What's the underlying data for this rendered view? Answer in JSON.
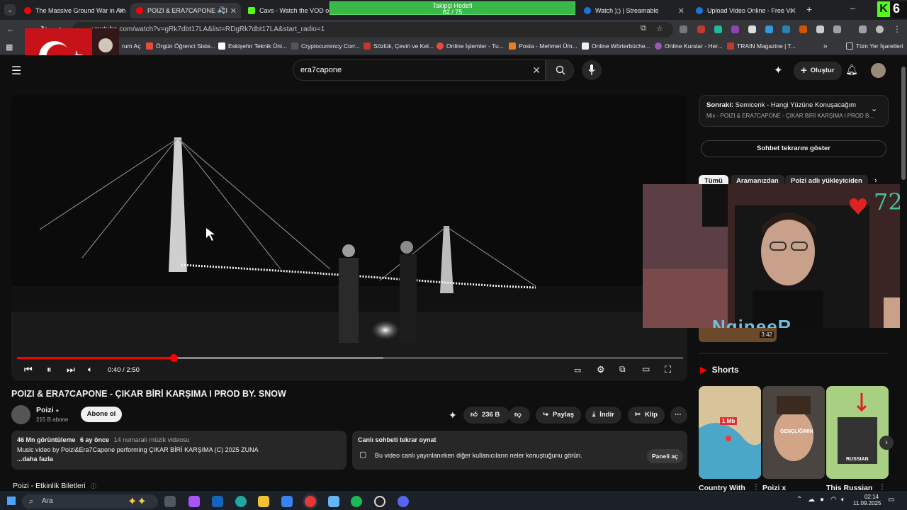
{
  "browser": {
    "tabs": [
      {
        "title": "The Massive Ground War in Am",
        "icon_color": "#ff0000"
      },
      {
        "title": "POIZI & ERA7CAPONE - ÇI",
        "icon_color": "#ff0000"
      },
      {
        "title": "Cavs - Watch the VOD on Ki",
        "icon_color": "#53fc18"
      },
      {
        "title": "Watch };) | Streamable",
        "icon_color": "#1a73e8"
      },
      {
        "title": "Upload Video Online - Free Vi",
        "icon_color": "#1a73e8"
      }
    ],
    "overlay_goal": {
      "line1": "Takipçi Hedefi",
      "line2": "82 / 75"
    },
    "url": "youtube.com/watch?v=gRk7dbt17LA&list=RDgRk7dbt17LA&start_radio=1",
    "bookmarks": [
      "rum Aç",
      "Örgün Öğrenci Siste...",
      "Eskişehir Teknik Üni...",
      "Cryptocurrency Corr...",
      "Sözlük, Çeviri ve Kel...",
      "Online İşlemler - Tu...",
      "Posta - Mehmet Üm...",
      "Online Wörterbüche...",
      "Online Kurslar - Her...",
      "TRAIN Magazine | T..."
    ],
    "all_bookmarks": "Tüm Yer İşaretleri",
    "overlay_k_badge": "6"
  },
  "youtube": {
    "search_value": "era7capone",
    "create_label": "Oluştur",
    "player": {
      "time": "0:40 / 2:50",
      "progress_fraction": 0.235,
      "buffer_fraction": 0.55
    },
    "video_title": "POIZI & ERA7CAPONE - ÇIKAR BİRİ KARŞIMA I PROD BY. SNOW",
    "channel": {
      "name": "Poizi",
      "subs": "215 B abone",
      "subscribe": "Abone ol"
    },
    "actions": {
      "likes": "236 B",
      "share": "Paylaş",
      "download": "İndir",
      "clip": "Klip"
    },
    "description": {
      "views": "46 Mn görüntüleme",
      "ago": "6 ay önce",
      "rank": "14 numaralı müzik videosu",
      "text": "Music video by Poizi&Era7Capone performing ÇIKAR BİRİ KARŞIMA (C) 2025 ZUNA",
      "more": "...daha fazla"
    },
    "live_chat_card": {
      "title": "Canlı sohbeti tekrar oynat",
      "text": "Bu video canlı yayınlanırken diğer kullanıcıların neler konuştuğunu görün.",
      "button": "Paneli aç"
    },
    "events": "Poizi - Etkinlik Biletleri",
    "sidebar": {
      "next_prefix": "Sonraki:",
      "next_title": "Semicenk - Hangi Yüzüne Konuşacağım",
      "next_sub": "Mix - POIZI & ERA7CAPONE - ÇIKAR BİRİ KARŞIMA I PROD B...",
      "chat_replay": "Sohbet tekrarını göster",
      "chips": [
        "Tümü",
        "Aramanızdan",
        "Poizi adlı yükleyiciden"
      ],
      "thumb_duration": "3:42",
      "shorts_heading": "Shorts",
      "shorts": [
        {
          "title": "Country With",
          "overlay": "1 Mb"
        },
        {
          "title": "Poizi x",
          "overlay": "GENÇLİĞİMİN"
        },
        {
          "title": "This Russian",
          "overlay": "RUSSIAN"
        }
      ]
    }
  },
  "stream_overlay": {
    "heart_count": "72",
    "brand": "NgineeR"
  },
  "taskbar": {
    "search": "Ara",
    "time": "02:14",
    "date": "11.09.2025"
  }
}
